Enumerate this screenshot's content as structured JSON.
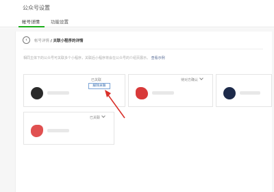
{
  "header": {
    "title": "公众号设置"
  },
  "tabs": [
    {
      "label": "帐号详情",
      "active": true
    },
    {
      "label": "功能设置",
      "active": false
    }
  ],
  "breadcrumb": {
    "parent": "帐号详情",
    "separator": "/",
    "current": "关联小程序的详情"
  },
  "notice": {
    "text": "相同主体下的公众号可关联多个小程序，关联后小程序将会在公众号的介绍页展示。",
    "link_label": "查看示例"
  },
  "cards": [
    {
      "status": "已关联",
      "action_label": "解除关联",
      "avatar_color": "#2a2a2a"
    },
    {
      "status": "待对方确认",
      "avatar_color": "#d83a3a"
    },
    {
      "status": "",
      "avatar_color": "#1d2a4a"
    },
    {
      "status": "已关联",
      "avatar_color": "#e05050"
    }
  ],
  "colors": {
    "accent_green": "#1aad19",
    "link_blue": "#576b95",
    "arrow_red": "#d9302a"
  }
}
